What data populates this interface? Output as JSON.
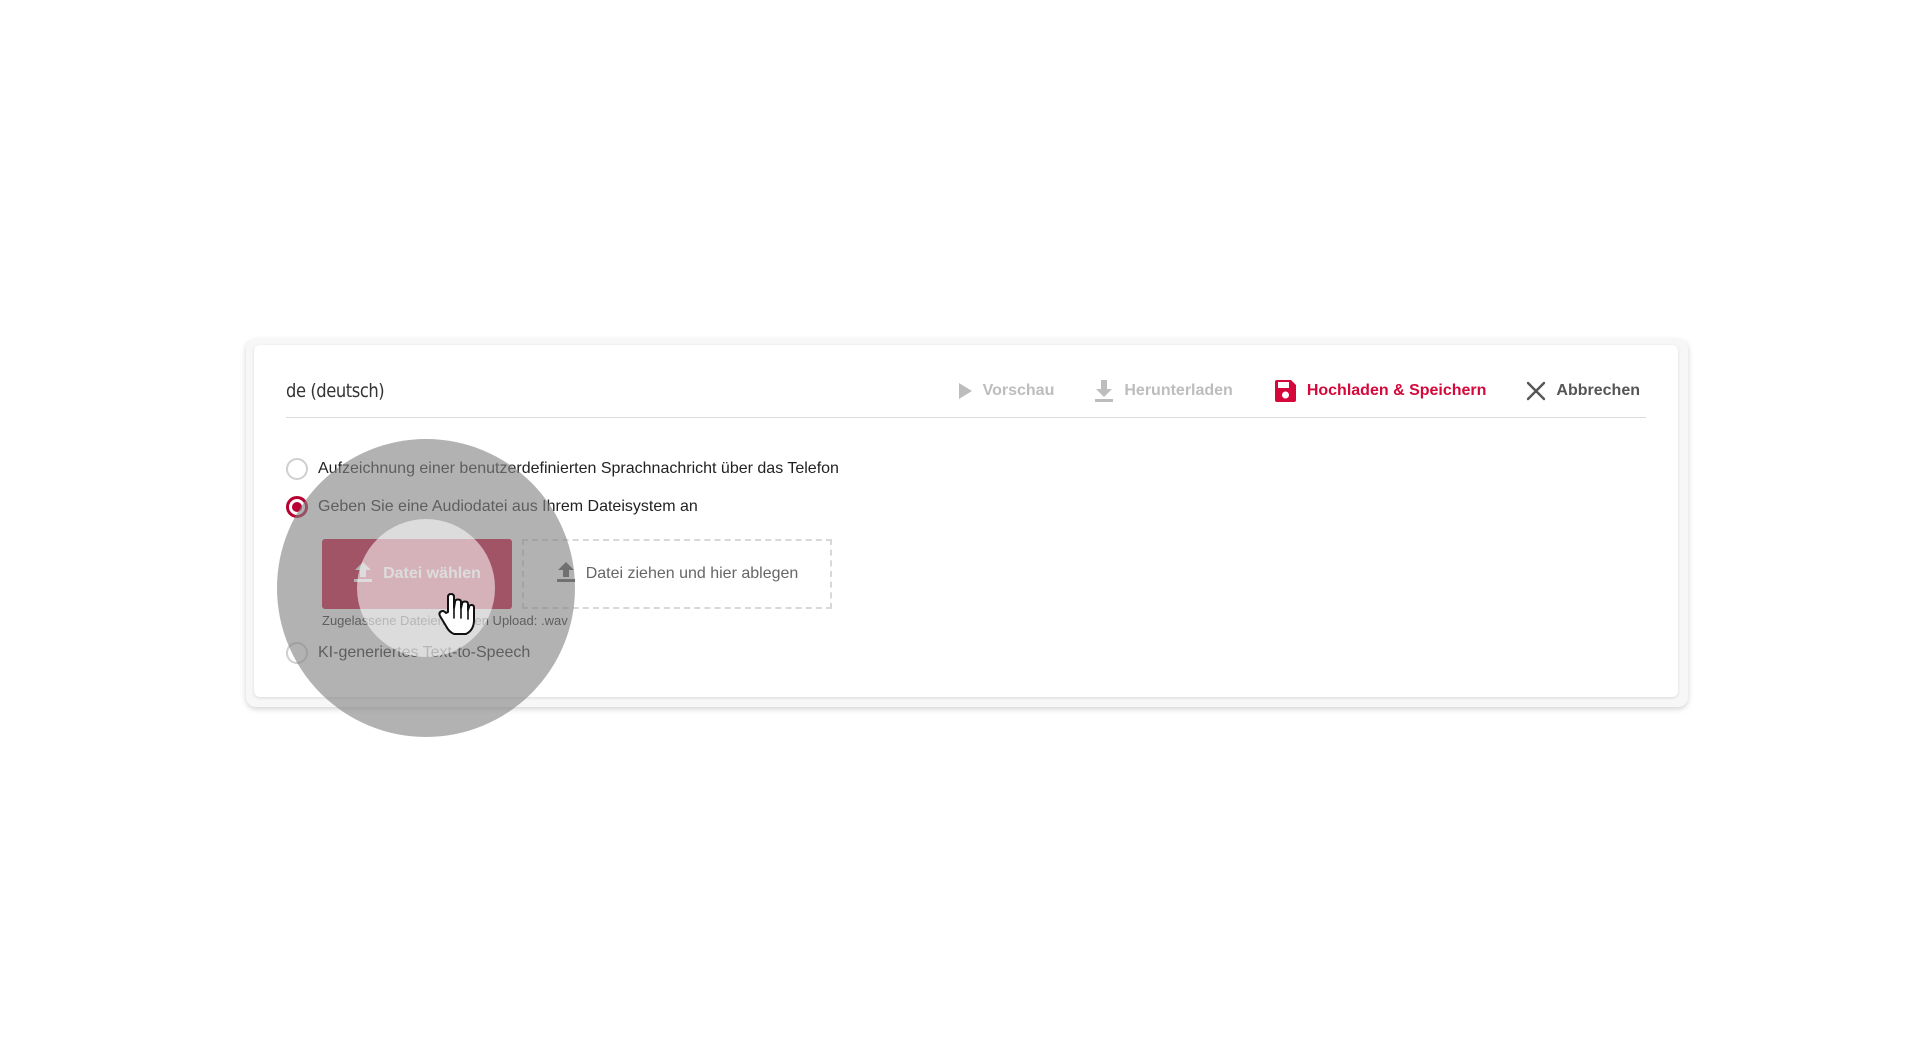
{
  "editor": {
    "title": "de (deutsch)",
    "toolbar": {
      "preview_label": "Vorschau",
      "download_label": "Herunterladen",
      "upload_save_label": "Hochladen & Speichern",
      "cancel_label": "Abbrechen"
    },
    "options": {
      "phone_recording_label": "Aufzeichnung einer benutzerdefinierten Sprachnachricht über das Telefon",
      "file_upload_label": "Geben Sie eine Audiodatei aus Ihrem Dateisystem an",
      "tts_label": "KI-generiertes Text-to-Speech"
    },
    "upload": {
      "choose_button_label": "Datei wählen",
      "drop_zone_label": "Datei ziehen und hier ablegen",
      "allowed_hint": "Zugelassene Dateien für den Upload: .wav"
    }
  },
  "colors": {
    "accent": "#d4083a",
    "radio_selected": "#b80032",
    "disabled_text": "#bdbdbd"
  },
  "icons": {
    "preview": "play-icon",
    "download": "download-icon",
    "save": "floppy-disk-icon",
    "cancel": "close-icon",
    "upload": "upload-icon",
    "cursor": "hand-pointer-icon"
  },
  "state": {
    "selected_option": "file_upload"
  }
}
